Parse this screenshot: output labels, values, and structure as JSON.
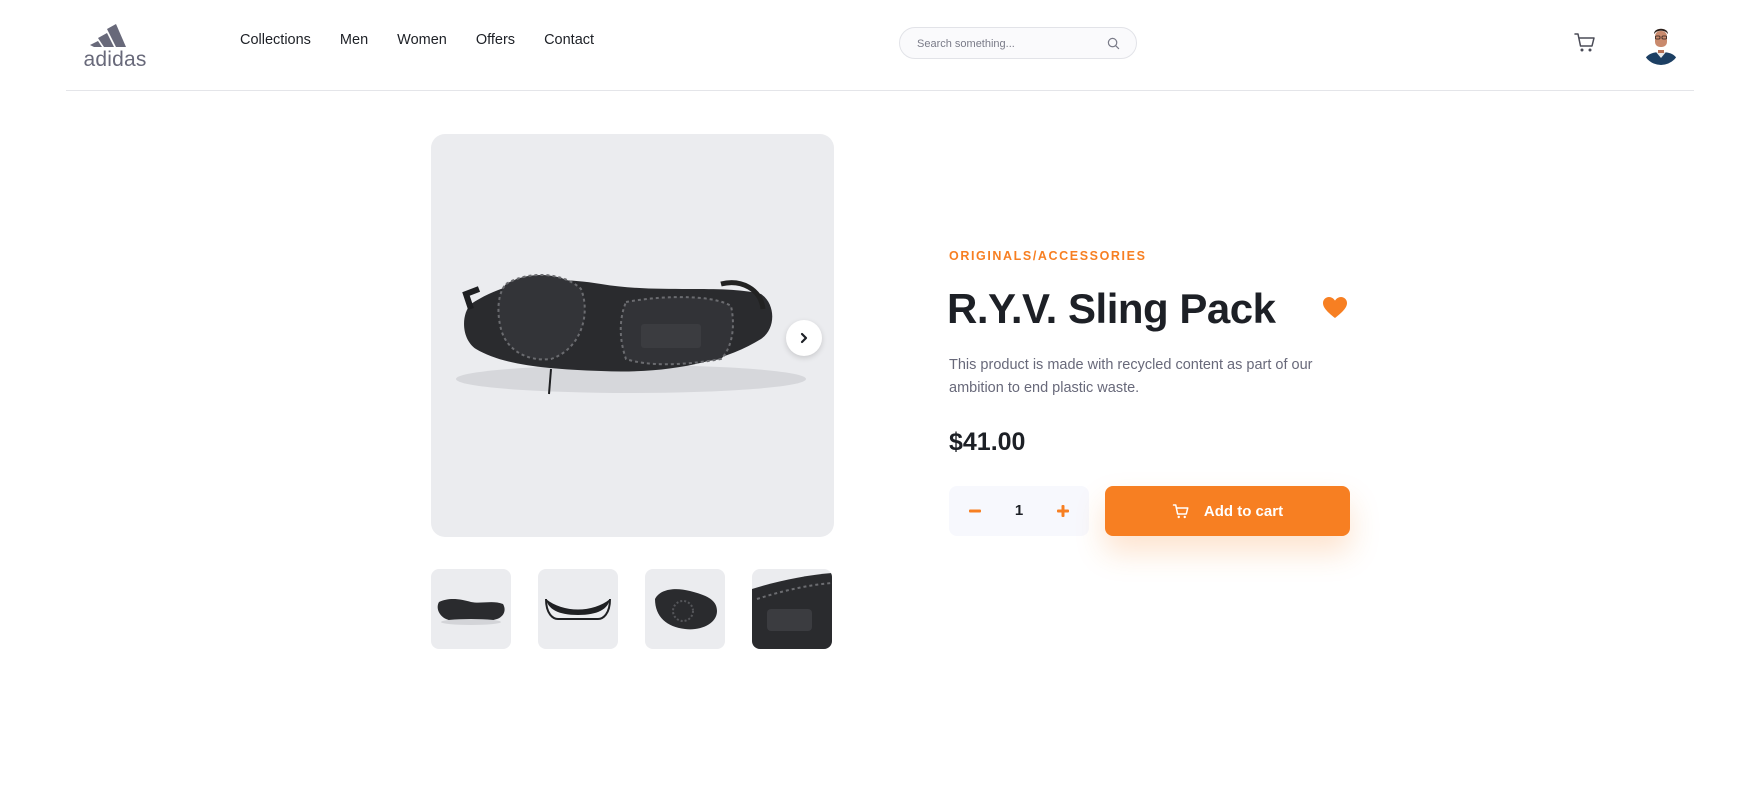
{
  "brand": {
    "name": "adidas"
  },
  "nav": {
    "items": [
      {
        "label": "Collections"
      },
      {
        "label": "Men"
      },
      {
        "label": "Women"
      },
      {
        "label": "Offers"
      },
      {
        "label": "Contact"
      }
    ]
  },
  "search": {
    "placeholder": "Search something...",
    "icon": "search-icon"
  },
  "header_icons": {
    "cart": "cart-icon",
    "avatar": "user-avatar"
  },
  "gallery": {
    "next_icon": "chevron-right-icon",
    "thumbnails": [
      {
        "name": "thumbnail-front"
      },
      {
        "name": "thumbnail-back"
      },
      {
        "name": "thumbnail-top"
      },
      {
        "name": "thumbnail-detail"
      }
    ]
  },
  "product": {
    "category": "ORIGINALS/ACCESSORIES",
    "title": "R.Y.V. Sling Pack",
    "description": "This product is made with recycled content as part of our ambition to end plastic waste.",
    "price": "$41.00",
    "quantity": "1",
    "add_to_cart_label": "Add to cart",
    "favorite_icon": "heart-icon"
  },
  "colors": {
    "accent": "#f77f22",
    "text_dark": "#1d2026",
    "text_muted": "#68697a",
    "image_bg": "#ebecef"
  }
}
